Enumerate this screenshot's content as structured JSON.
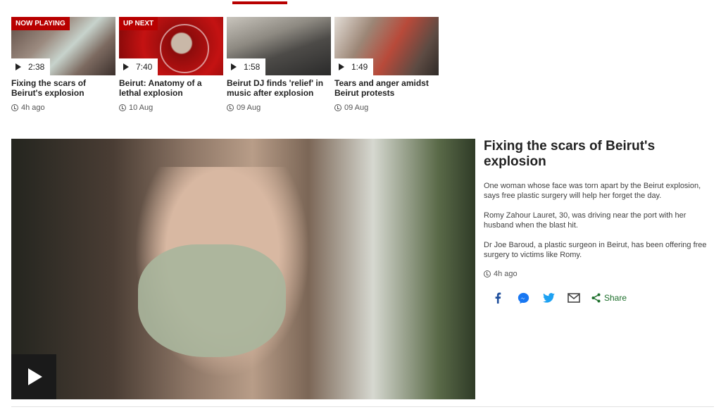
{
  "playlist": [
    {
      "badge": "NOW PLAYING",
      "duration": "2:38",
      "title": "Fixing the scars of Beirut's explosion",
      "time": "4h ago"
    },
    {
      "badge": "UP NEXT",
      "duration": "7:40",
      "title": "Beirut: Anatomy of a lethal explosion",
      "time": "10 Aug"
    },
    {
      "badge": "",
      "duration": "1:58",
      "title": "Beirut DJ finds 'relief' in music after explosion",
      "time": "09 Aug"
    },
    {
      "badge": "",
      "duration": "1:49",
      "title": "Tears and anger amidst Beirut protests",
      "time": "09 Aug"
    }
  ],
  "story": {
    "title": "Fixing the scars of Beirut's explosion",
    "paragraphs": [
      "One woman whose face was torn apart by the Beirut explosion, says free plastic surgery will help her forget the day.",
      "Romy Zahour Lauret, 30, was driving near the port with her husband when the blast hit.",
      "Dr Joe Baroud, a plastic surgeon in Beirut, has been offering free surgery to victims like Romy."
    ],
    "time": "4h ago"
  },
  "share": {
    "label": "Share",
    "icons": [
      "facebook-icon",
      "messenger-icon",
      "twitter-icon",
      "email-icon",
      "share-icon"
    ]
  },
  "colors": {
    "accent": "#b80000",
    "share_green": "#1d6f2b",
    "facebook": "#1f4f9c",
    "messenger": "#1877f2",
    "twitter": "#1da1f2"
  }
}
